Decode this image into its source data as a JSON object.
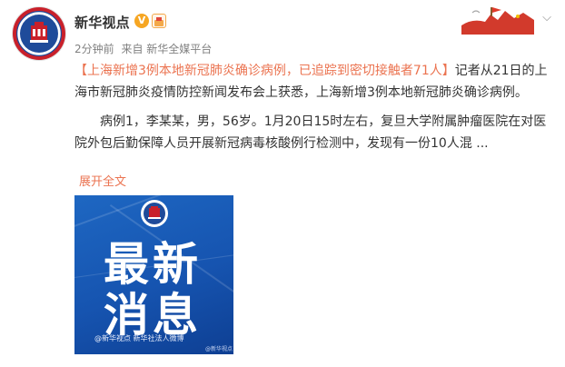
{
  "post": {
    "account_name": "新华视点",
    "verified_badge": "V",
    "meta": {
      "time": "2分钟前",
      "source": "来自 新华全媒平台"
    },
    "text": {
      "headline": "【上海新增3例本地新冠肺炎确诊病例，已追踪到密切接触者71人】",
      "body": "记者从21日的上海市新冠肺炎疫情防控新闻发布会上获悉，上海新增3例本地新冠肺炎确诊病例。",
      "para2": "病例1，李某某，男，56岁。1月20日15时左右，复旦大学附属肿瘤医院在对医院外包后勤保障人员开展新冠病毒核酸例行检测中，发现有一份10人混 ..."
    },
    "expand_label": "展开全文",
    "image": {
      "line1": "最新",
      "line2": "消息",
      "footer": "@新华视点 新华社法人微博",
      "watermark": "@新华视点"
    }
  },
  "colors": {
    "accent": "#eb7350",
    "image_blue": "#1654b0",
    "avatar_red": "#c9202a"
  },
  "icons": [
    "avatar-logo",
    "verified-icon",
    "level-icon",
    "banner-decoration",
    "chevron-down-icon"
  ]
}
